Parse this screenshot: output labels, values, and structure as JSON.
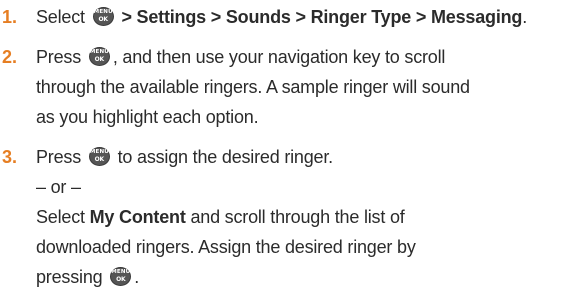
{
  "menu_key": {
    "line1": "MENU",
    "line2": "OK",
    "icon": "menu-ok-key-icon"
  },
  "colors": {
    "step_number": "#e67e22",
    "text": "#2b2b2b",
    "key_fill": "#555555"
  },
  "steps": [
    {
      "number": "1.",
      "l1_a": "Select ",
      "l1_b": " > Settings > Sounds > Ringer Type > Messaging",
      "l1_c": "."
    },
    {
      "number": "2.",
      "l1_a": "Press ",
      "l1_b": ", and then use your navigation key to scroll",
      "l2": "through the available ringers. A sample ringer will sound",
      "l3": "as you highlight each option."
    },
    {
      "number": "3.",
      "l1_a": "Press ",
      "l1_b": " to assign the desired ringer.",
      "l2": "– or –",
      "l3_a": "Select ",
      "l3_b": "My Content",
      "l3_c": " and scroll through the list of",
      "l4": "downloaded ringers. Assign the desired ringer by",
      "l5_a": "pressing ",
      "l5_b": "."
    }
  ]
}
